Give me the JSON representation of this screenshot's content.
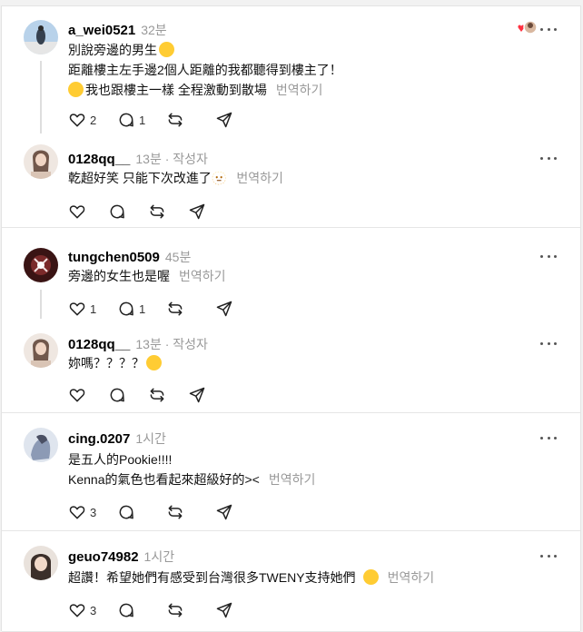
{
  "posts": [
    {
      "username": "a_wei0521",
      "meta": "32분",
      "lines": [
        "別說旁邊的男生",
        "距離樓主左手邊2個人距離的我都聽得到樓主了！",
        "我也跟樓主一樣 全程激動到散場"
      ],
      "translate": "번역하기",
      "likes": "2",
      "replies": "1",
      "avatar_color": "#6f8fb5"
    },
    {
      "username": "0128qq__",
      "meta": "13분 · 작성자",
      "lines": [
        "乾超好笑 只能下次改進了🫥"
      ],
      "translate": "번역하기",
      "avatar_color": "#c9a28a"
    },
    {
      "username": "tungchen0509",
      "meta": "45분",
      "lines": [
        "旁邊的女生也是喔"
      ],
      "translate": "번역하기",
      "likes": "1",
      "replies": "1",
      "avatar_color": "#5a2a2a"
    },
    {
      "username": "0128qq__",
      "meta": "13분 · 작성자",
      "lines": [
        "妳嗎？？？？"
      ],
      "translate": "",
      "avatar_color": "#c9a28a"
    },
    {
      "username": "cing.0207",
      "meta": "1시간",
      "lines": [
        "是五人的Pookie!!!!",
        "Kenna的氣色也看起來超級好的><"
      ],
      "translate": "번역하기",
      "likes": "3",
      "avatar_color": "#8c9ab5"
    },
    {
      "username": "geuo74982",
      "meta": "1시간",
      "lines": [
        "超讚！希望她們有感受到台灣很多TWENY支持她們"
      ],
      "translate": "번역하기",
      "likes": "3",
      "avatar_color": "#b9a59a"
    }
  ],
  "icons": {
    "like": "heart-icon",
    "reply": "comment-icon",
    "repost": "repost-icon",
    "share": "send-icon",
    "more": "more-icon"
  },
  "colors": {
    "muted": "#999999",
    "divider": "#e6e6e6",
    "heart": "#ff3040"
  }
}
